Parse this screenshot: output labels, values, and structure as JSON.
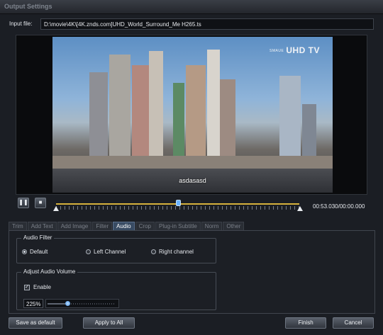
{
  "window": {
    "title": "Output Settings"
  },
  "input": {
    "label": "Input file:",
    "path": "D:\\movie\\4K\\[4K.znds.com]UHD_World_Surround_Me H265.ts"
  },
  "preview": {
    "channel_logo": "UHD TV",
    "channel_logo_small": "SMAUE",
    "caption": "asdasasd"
  },
  "playback": {
    "pause_icon": "pause-icon",
    "stop_icon": "stop-icon",
    "position_fraction": 0.5,
    "timecode": "00:53.030/00:00.000"
  },
  "tabs": [
    "Trim",
    "Add Text",
    "Add Image",
    "Filter",
    "Audio",
    "Crop",
    "Plug-in Subtitle",
    "Norm",
    "Other"
  ],
  "active_tab": "Audio",
  "audio_filter": {
    "title": "Audio Filter",
    "options": [
      "Default",
      "Left Channel",
      "Right channel"
    ],
    "selected": "Default"
  },
  "audio_volume": {
    "title": "Adjust Audio Volume",
    "enable_label": "Enable",
    "enabled": true,
    "value": "225%",
    "level_fraction": 0.25
  },
  "buttons": {
    "save_default": "Save as default",
    "apply_all": "Apply to All",
    "finish": "Finish",
    "cancel": "Cancel"
  },
  "colors": {
    "accent": "#d6b13c",
    "active_tab": "#384b63",
    "slider_knob": "#6bb3ff"
  }
}
